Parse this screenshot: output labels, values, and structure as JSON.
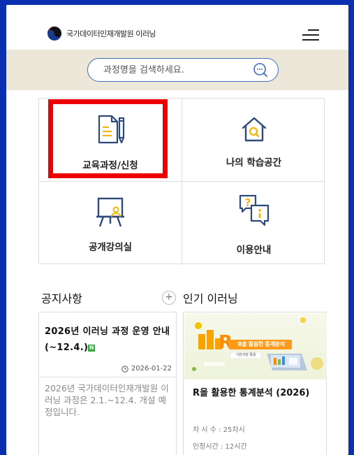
{
  "header": {
    "logo_text": "국가데이터인재개발원 이러닝"
  },
  "search": {
    "placeholder": "과정명을 검색하세요."
  },
  "menu_grid": [
    {
      "label": "교육과정/신청",
      "icon": "document-pencil-icon"
    },
    {
      "label": "나의 학습공간",
      "icon": "house-search-icon"
    },
    {
      "label": "공개강의실",
      "icon": "presentation-board-icon"
    },
    {
      "label": "이용안내",
      "icon": "question-info-chat-icon"
    }
  ],
  "notice": {
    "section_title": "공지사항",
    "title": "2026년 이러닝 과정 운영 안내(~12.4.)",
    "badge": "N",
    "date": "2026-01-22",
    "body": "2026년 국가데이터인재개발원 이러닝 과정은 2.1.~12.4. 개설 예정입니다."
  },
  "popular": {
    "section_title": "인기 이러닝",
    "thumb_text": "R을 활용한 통계분석",
    "thumb_sub": "기본과정 활용",
    "title": "R을 활용한 통계분석 (2026)",
    "sessions": "차 시 수 : 25차시",
    "hours": "인정시간 : 12시간"
  },
  "colors": {
    "frame_border": "#0a2fb0",
    "search_band": "#ece7d9",
    "search_border": "#3c6cb8",
    "highlight": "#ee0000",
    "icon_stroke": "#2d4a7a",
    "icon_accent": "#f2b705"
  }
}
